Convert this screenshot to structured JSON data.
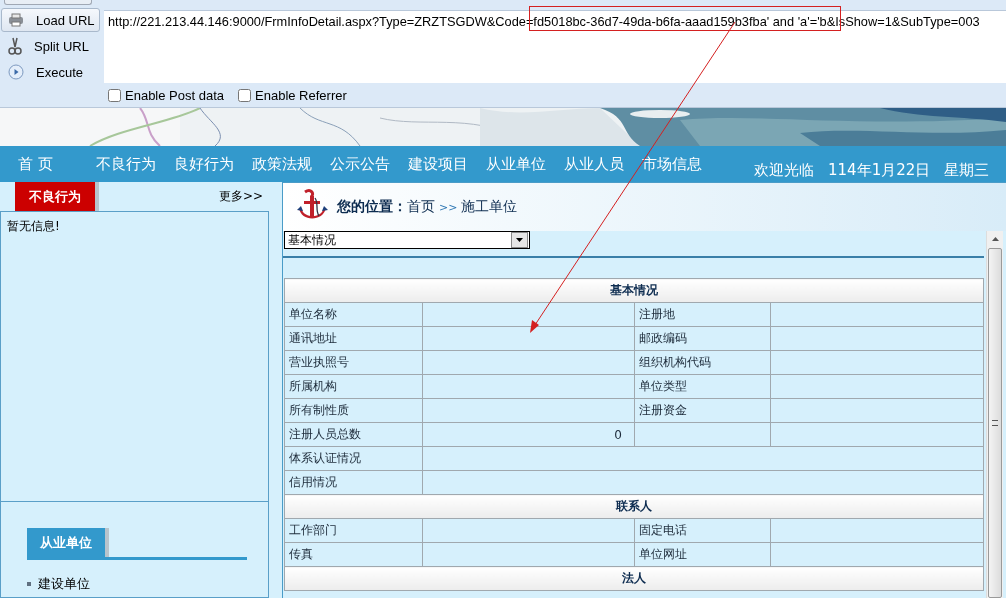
{
  "toolbar": {
    "actions": [
      {
        "label": "Load URL",
        "kind": "load",
        "selected": true
      },
      {
        "label": "Split URL",
        "kind": "split",
        "selected": false
      },
      {
        "label": "Execute",
        "kind": "execute",
        "selected": false
      }
    ],
    "url": "http://221.213.44.146:9000/FrmInfoDetail.aspx?Type=ZRZTSGDW&Code=fd5018bc-36d7-49da-b6fa-aaad159b3fba' and 'a'='b&IsShow=1&SubType=003",
    "options": [
      {
        "label": "Enable Post data",
        "checked": false
      },
      {
        "label": "Enable Referrer",
        "checked": false
      }
    ]
  },
  "nav": {
    "items": [
      "首 页",
      "不良行为",
      "良好行为",
      "政策法规",
      "公示公告",
      "建设项目",
      "从业单位",
      "从业人员",
      "市场信息"
    ],
    "welcome": "欢迎光临",
    "date": "114年1月22日",
    "weekday": "星期三"
  },
  "sidebar": {
    "tab": "不良行为",
    "more": "更多>>",
    "message": "暂无信息!",
    "section_title": "从业单位",
    "links": [
      "建设单位"
    ]
  },
  "breadcrumb": {
    "label": "您的位置：",
    "home": "首页",
    "separator": ">>",
    "current": "施工单位"
  },
  "select": {
    "value": "基本情况"
  },
  "table": {
    "sections": [
      {
        "title": "基本情况",
        "rows": [
          {
            "kind": "pair",
            "label": "单位名称",
            "label_2": "注册地"
          },
          {
            "kind": "pair",
            "label": "通讯地址",
            "label_2": "邮政编码"
          },
          {
            "kind": "pair",
            "label": "营业执照号",
            "label_2": "组织机构代码"
          },
          {
            "kind": "pair",
            "label": "所属机构",
            "label_2": "单位类型"
          },
          {
            "kind": "pair",
            "label": "所有制性质",
            "label_2": "注册资金"
          },
          {
            "kind": "pair",
            "label": "注册人员总数",
            "value": "0"
          },
          {
            "kind": "wide",
            "label": "体系认证情况"
          },
          {
            "kind": "wide",
            "label": "信用情况"
          }
        ]
      },
      {
        "title": "联系人",
        "rows": [
          {
            "kind": "pair",
            "label": "工作部门",
            "label_2": "固定电话"
          },
          {
            "kind": "pair",
            "label": "传真",
            "label_2": "单位网址"
          }
        ]
      },
      {
        "title": "法人"
      }
    ]
  }
}
